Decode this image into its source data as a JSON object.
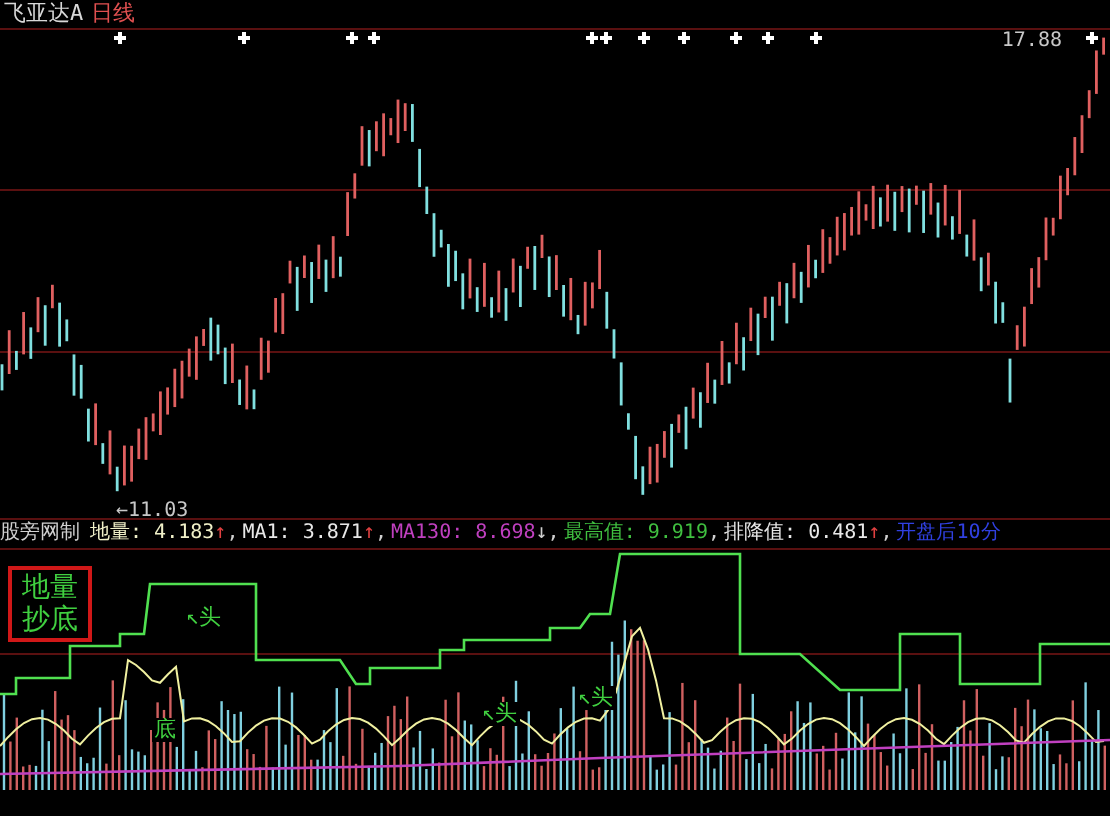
{
  "title_bar": {
    "stock_name": "飞亚达A",
    "period": "日线"
  },
  "price_chart": {
    "high_label": "17.88",
    "low_label": "←11.03"
  },
  "indicator_header": {
    "source": "股旁网制",
    "items": [
      {
        "label": "地量: ",
        "value": "4.183",
        "arrow": "↑",
        "sep": ",",
        "color": "#f0f0c8"
      },
      {
        "label": "MA1: ",
        "value": "3.871",
        "arrow": "↑",
        "sep": ",",
        "color": "#e8e8e8"
      },
      {
        "label": "MA130: ",
        "value": "8.698",
        "arrow": "↓",
        "sep": ",",
        "color": "#c040c0"
      },
      {
        "label": "最高值: ",
        "value": "9.919",
        "sep": ",",
        "color": "#40c040"
      },
      {
        "label": "排降值: ",
        "value": "0.481",
        "arrow": "↑",
        "sep": ",",
        "color": "#e8e8e8"
      },
      {
        "label": "开盘后10分",
        "color": "#3040e0"
      }
    ]
  },
  "indicator_panel": {
    "legend": [
      "地量",
      "抄底"
    ],
    "annotations": [
      "↖头",
      "底",
      "↖头",
      "↖头"
    ]
  }
}
